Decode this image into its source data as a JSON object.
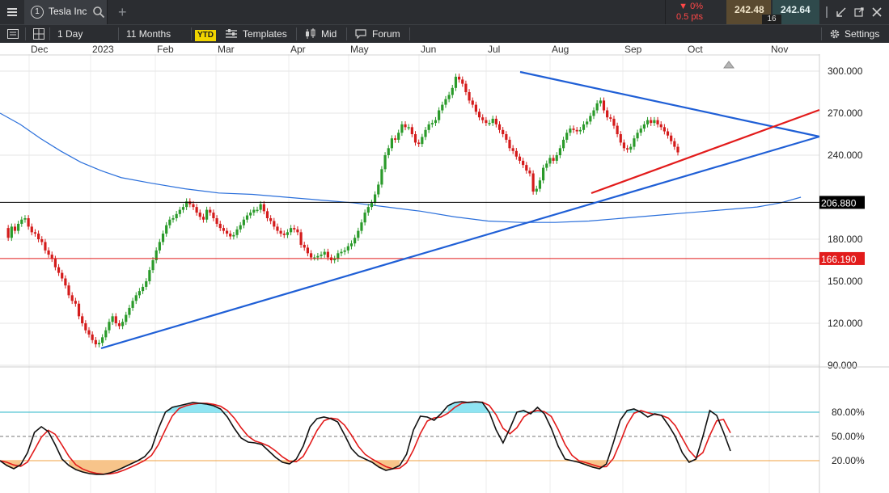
{
  "header": {
    "symbol_badge": "1",
    "symbol_name": "Tesla Inc",
    "change_pct": "▼ 0%",
    "change_pts": "0.5 pts",
    "bid": "242.48",
    "ask": "242.64",
    "spread": "16"
  },
  "toolbar": {
    "interval": "1 Day",
    "range": "11 Months",
    "ytd": "YTD",
    "templates": "Templates",
    "price_type": "Mid",
    "forum": "Forum",
    "settings": "Settings"
  },
  "chart_data": [
    {
      "type": "candlestick",
      "x_axis_labels": [
        "Dec",
        "2023",
        "Feb",
        "Mar",
        "Apr",
        "May",
        "Jun",
        "Jul",
        "Aug",
        "Sep",
        "Oct",
        "Nov"
      ],
      "y_axis_labels": [
        "300.000",
        "270.000",
        "240.000",
        "180.000",
        "150.000",
        "120.000",
        "90.000"
      ],
      "ylim": [
        90,
        305
      ],
      "grid": true,
      "horizontal_levels": [
        {
          "value": "206.880",
          "color": "#000000"
        },
        {
          "value": "166.190",
          "color": "#e21b1b"
        }
      ],
      "trendlines": [
        {
          "color": "#1f5fd6",
          "from": [
            "2023-01-06",
            102
          ],
          "to": [
            "2023-11-10",
            252
          ]
        },
        {
          "color": "#1f5fd6",
          "from": [
            "2023-07-19",
            299
          ],
          "to": [
            "2023-11-10",
            252
          ]
        },
        {
          "color": "#e21b1b",
          "from": [
            "2023-08-18",
            212
          ],
          "to": [
            "2023-11-10",
            272
          ]
        }
      ],
      "moving_average": {
        "color": "#2a6fdb",
        "points": [
          [
            0,
            270
          ],
          [
            6,
            262
          ],
          [
            12,
            252
          ],
          [
            18,
            243
          ],
          [
            24,
            235
          ],
          [
            30,
            229
          ],
          [
            36,
            224
          ],
          [
            45,
            220
          ],
          [
            55,
            216
          ],
          [
            65,
            213
          ],
          [
            75,
            212
          ],
          [
            85,
            210
          ],
          [
            95,
            208
          ],
          [
            105,
            206
          ],
          [
            115,
            203
          ],
          [
            125,
            200
          ],
          [
            135,
            196
          ],
          [
            145,
            193
          ],
          [
            155,
            192
          ],
          [
            165,
            192
          ],
          [
            175,
            193
          ],
          [
            185,
            195
          ],
          [
            195,
            197
          ],
          [
            205,
            199
          ],
          [
            215,
            201
          ],
          [
            225,
            203
          ],
          [
            232,
            206
          ],
          [
            238,
            210
          ]
        ]
      },
      "candles_close": [
        188,
        181,
        189,
        186,
        191,
        194,
        195,
        189,
        185,
        184,
        180,
        178,
        172,
        169,
        166,
        160,
        156,
        152,
        147,
        140,
        136,
        134,
        125,
        120,
        115,
        112,
        108,
        105,
        106,
        110,
        115,
        121,
        125,
        120,
        118,
        121,
        126,
        131,
        136,
        140,
        143,
        146,
        150,
        158,
        165,
        172,
        178,
        184,
        190,
        194,
        195,
        198,
        201,
        203,
        207,
        205,
        203,
        199,
        196,
        194,
        201,
        199,
        195,
        191,
        188,
        186,
        184,
        182,
        183,
        187,
        190,
        194,
        197,
        199,
        201,
        201,
        205,
        200,
        195,
        193,
        189,
        186,
        184,
        183,
        185,
        188,
        187,
        185,
        176,
        174,
        170,
        167,
        167,
        168,
        169,
        171,
        167,
        165,
        166,
        170,
        171,
        172,
        175,
        177,
        181,
        186,
        192,
        199,
        203,
        206,
        212,
        219,
        230,
        240,
        245,
        252,
        251,
        256,
        262,
        260,
        260,
        255,
        249,
        248,
        253,
        258,
        262,
        263,
        265,
        272,
        276,
        280,
        283,
        288,
        296,
        294,
        291,
        285,
        279,
        276,
        271,
        267,
        265,
        263,
        263,
        266,
        262,
        258,
        255,
        251,
        245,
        243,
        239,
        236,
        233,
        229,
        227,
        214,
        216,
        222,
        231,
        234,
        238,
        236,
        240,
        245,
        251,
        256,
        259,
        258,
        257,
        258,
        262,
        264,
        268,
        272,
        277,
        279,
        272,
        267,
        266,
        261,
        255,
        249,
        245,
        244,
        246,
        252,
        256,
        259,
        262,
        265,
        263,
        265,
        262,
        260,
        257,
        254,
        250,
        246,
        242
      ],
      "stochastic": {
        "levels": [
          "80.00%",
          "50.00%",
          "20.00%"
        ],
        "upper_level": 80,
        "mid_level": 50,
        "lower_level": 20,
        "k_color": "#111111",
        "d_color": "#e21b1b",
        "k": [
          20,
          14,
          10,
          15,
          30,
          55,
          62,
          56,
          40,
          22,
          14,
          9,
          6,
          4,
          3,
          3,
          5,
          8,
          12,
          16,
          20,
          25,
          35,
          60,
          80,
          86,
          88,
          90,
          92,
          91,
          90,
          88,
          84,
          74,
          60,
          48,
          43,
          42,
          40,
          32,
          24,
          18,
          16,
          22,
          38,
          62,
          72,
          74,
          72,
          68,
          52,
          35,
          26,
          22,
          18,
          12,
          8,
          10,
          14,
          28,
          58,
          75,
          74,
          70,
          78,
          88,
          92,
          93,
          92,
          93,
          92,
          80,
          58,
          42,
          60,
          80,
          82,
          78,
          86,
          78,
          60,
          38,
          22,
          20,
          18,
          15,
          12,
          10,
          16,
          42,
          70,
          82,
          84,
          80,
          74,
          78,
          76,
          64,
          50,
          30,
          18,
          22,
          50,
          82,
          76,
          55,
          32
        ]
      }
    }
  ]
}
